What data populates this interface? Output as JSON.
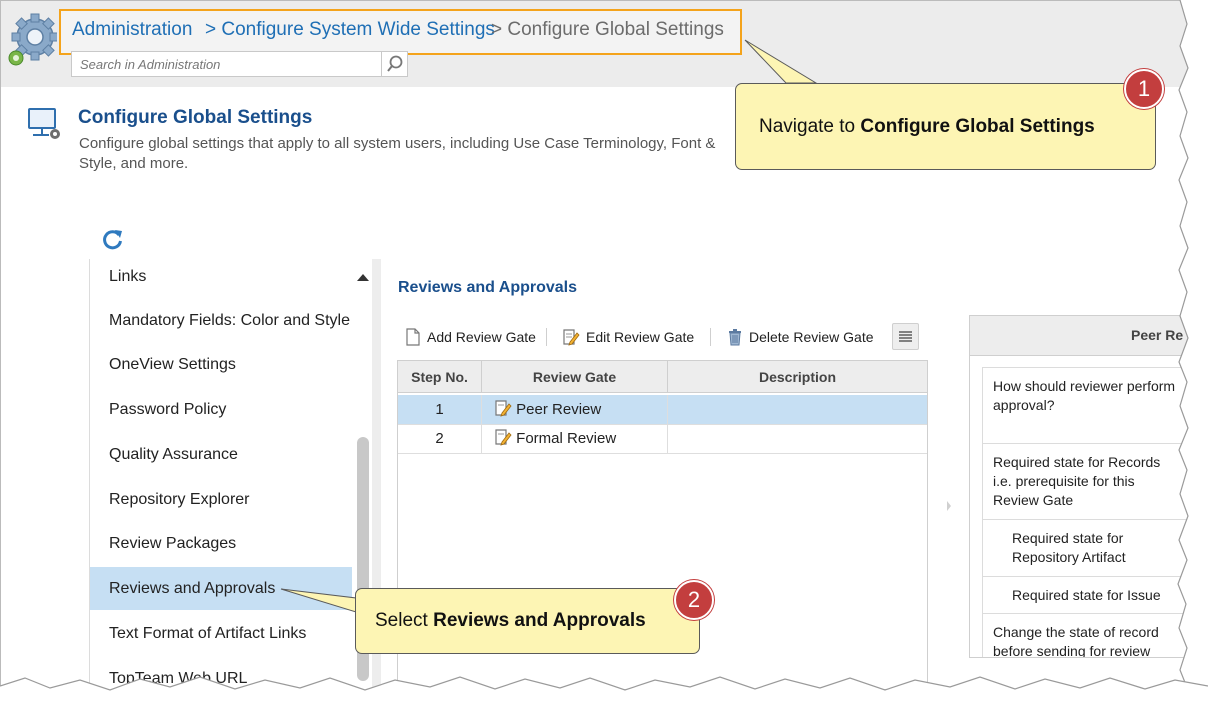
{
  "breadcrumb": {
    "items": [
      "Administration",
      "> Configure System Wide Settings",
      "> Configure Global Settings"
    ]
  },
  "search": {
    "placeholder": "Search in Administration"
  },
  "page": {
    "title": "Configure Global Settings",
    "description": "Configure global settings that apply to all system users, including Use Case Terminology, Font & Style, and more."
  },
  "nav": {
    "items": [
      "Links",
      "Mandatory Fields: Color and Style",
      "OneView Settings",
      "Password Policy",
      "Quality Assurance",
      "Repository Explorer",
      "Review Packages",
      "Reviews and Approvals",
      "Text Format of Artifact Links",
      "TopTeam Web URL"
    ],
    "selected": "Reviews and Approvals"
  },
  "section": {
    "title": "Reviews and Approvals"
  },
  "toolbar": {
    "add": "Add Review Gate",
    "edit": "Edit Review Gate",
    "delete": "Delete Review Gate"
  },
  "grid": {
    "columns": [
      "Step No.",
      "Review Gate",
      "Description"
    ],
    "rows": [
      {
        "step": "1",
        "gate": "Peer Review",
        "description": ""
      },
      {
        "step": "2",
        "gate": "Formal Review",
        "description": ""
      }
    ]
  },
  "details": {
    "header": "Peer Re",
    "questions": [
      "How should reviewer perform approval?",
      "Required state for Records i.e. prerequisite for this Review Gate",
      "Required state for Repository Artifact",
      "Required state for Issue",
      "Change the state of record before sending for review"
    ]
  },
  "callouts": {
    "one": {
      "number": "1",
      "prefix": "Navigate to ",
      "bold": "Configure Global Settings"
    },
    "two": {
      "number": "2",
      "prefix": "Select ",
      "bold": "Reviews and Approvals"
    }
  },
  "colors": {
    "accent": "#1a4f8c",
    "link": "#1f6fb5",
    "highlight": "#f4a31b",
    "selection": "#c6dff3",
    "callout_bg": "#fdf5b4",
    "badge": "#c33e3e"
  }
}
